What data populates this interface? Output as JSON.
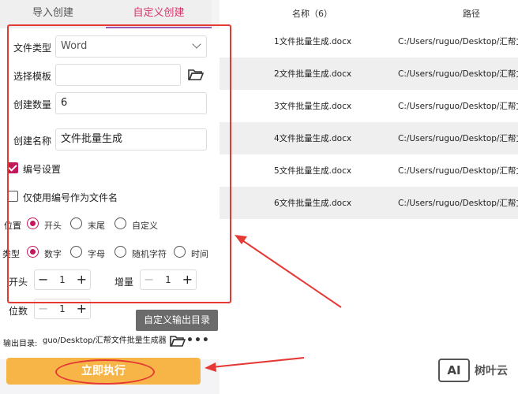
{
  "tabs": [
    {
      "label": "导入创建"
    },
    {
      "label": "自定义创建"
    }
  ],
  "form": {
    "file_type_label": "文件类型",
    "file_type_value": "Word",
    "template_label": "选择模板",
    "template_value": "",
    "count_label": "创建数量",
    "count_value": "6",
    "name_label": "创建名称",
    "name_value": "文件批量生成",
    "numbering_label": "编号设置",
    "only_number_label": "仅使用编号作为文件名",
    "position_label": "位置",
    "position_options": [
      "开头",
      "末尾",
      "自定义"
    ],
    "type_label": "类型",
    "type_options": [
      "数字",
      "字母",
      "随机字符",
      "时间"
    ],
    "start_label": "开头",
    "start_value": "1",
    "increment_label": "增量",
    "increment_value": "1",
    "digits_label": "位数",
    "digits_value": "1"
  },
  "tooltip": "自定义输出目录",
  "output": {
    "label": "输出目录:",
    "path": "guo/Desktop/汇帮文件批量生成器"
  },
  "execute_label": "立即执行",
  "table": {
    "col_name": "名称（6）",
    "col_path": "路径",
    "rows": [
      {
        "name": "1文件批量生成.docx",
        "path": "C:/Users/ruguo/Desktop/汇帮文件"
      },
      {
        "name": "2文件批量生成.docx",
        "path": "C:/Users/ruguo/Desktop/汇帮文件"
      },
      {
        "name": "3文件批量生成.docx",
        "path": "C:/Users/ruguo/Desktop/汇帮文件"
      },
      {
        "name": "4文件批量生成.docx",
        "path": "C:/Users/ruguo/Desktop/汇帮文件"
      },
      {
        "name": "5文件批量生成.docx",
        "path": "C:/Users/ruguo/Desktop/汇帮文件"
      },
      {
        "name": "6文件批量生成.docx",
        "path": "C:/Users/ruguo/Desktop/汇帮文件"
      }
    ]
  },
  "watermark": {
    "logo": "AI",
    "text": "树叶云"
  },
  "colors": {
    "accent": "#c2185b",
    "execute": "#f7b547",
    "annotation": "#e53935"
  }
}
